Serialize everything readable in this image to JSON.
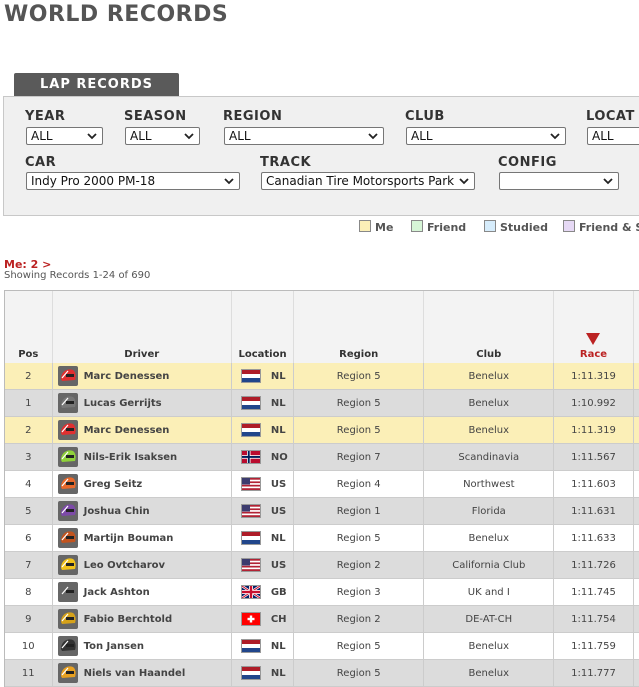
{
  "page": {
    "title": "WORLD RECORDS"
  },
  "tab": {
    "label": "LAP RECORDS"
  },
  "filters": {
    "year": {
      "label": "YEAR",
      "value": "ALL"
    },
    "season": {
      "label": "SEASON",
      "value": "ALL"
    },
    "region": {
      "label": "REGION",
      "value": "ALL"
    },
    "club": {
      "label": "CLUB",
      "value": "ALL"
    },
    "location": {
      "label": "LOCAT",
      "value": "ALL"
    },
    "car": {
      "label": "CAR",
      "value": "Indy Pro 2000 PM-18"
    },
    "track": {
      "label": "TRACK",
      "value": "Canadian Tire Motorsports Park"
    },
    "config": {
      "label": "CONFIG",
      "value": ""
    }
  },
  "legend": [
    {
      "label": "Me",
      "color": "#fbefb7"
    },
    {
      "label": "Friend",
      "color": "#d6f5d6"
    },
    {
      "label": "Studied",
      "color": "#d6ecfb"
    },
    {
      "label": "Friend & St",
      "color": "#e6d9f5"
    }
  ],
  "me_link": "Me: 2 >",
  "showing": "Showing Records 1-24 of 690",
  "columns": {
    "pos": "Pos",
    "driver": "Driver",
    "location": "Location",
    "region": "Region",
    "club": "Club",
    "race": "Race"
  },
  "rows": [
    {
      "pos": "2",
      "driver": "Marc Denessen",
      "country": "NL",
      "region": "Region 5",
      "club": "Benelux",
      "time": "1:11.319",
      "style": "me",
      "helmet": "#e03030",
      "flag": "nl"
    },
    {
      "pos": "1",
      "driver": "Lucas Gerrijts",
      "country": "NL",
      "region": "Region 5",
      "club": "Benelux",
      "time": "1:10.992",
      "style": "even",
      "helmet": "#777777",
      "flag": "nl"
    },
    {
      "pos": "2",
      "driver": "Marc Denessen",
      "country": "NL",
      "region": "Region 5",
      "club": "Benelux",
      "time": "1:11.319",
      "style": "me",
      "helmet": "#e03030",
      "flag": "nl"
    },
    {
      "pos": "3",
      "driver": "Nils-Erik Isaksen",
      "country": "NO",
      "region": "Region 7",
      "club": "Scandinavia",
      "time": "1:11.567",
      "style": "even",
      "helmet": "#8fd23a",
      "flag": "no"
    },
    {
      "pos": "4",
      "driver": "Greg Seitz",
      "country": "US",
      "region": "Region 4",
      "club": "Northwest",
      "time": "1:11.603",
      "style": "odd",
      "helmet": "#e8682a",
      "flag": "us"
    },
    {
      "pos": "5",
      "driver": "Joshua Chin",
      "country": "US",
      "region": "Region 1",
      "club": "Florida",
      "time": "1:11.631",
      "style": "even",
      "helmet": "#7d4aa8",
      "flag": "us"
    },
    {
      "pos": "6",
      "driver": "Martijn Bouman",
      "country": "NL",
      "region": "Region 5",
      "club": "Benelux",
      "time": "1:11.633",
      "style": "odd",
      "helmet": "#c2541f",
      "flag": "nl"
    },
    {
      "pos": "7",
      "driver": "Leo Ovtcharov",
      "country": "US",
      "region": "Region 2",
      "club": "California Club",
      "time": "1:11.726",
      "style": "even",
      "helmet": "#f2c21a",
      "flag": "us"
    },
    {
      "pos": "8",
      "driver": "Jack Ashton",
      "country": "GB",
      "region": "Region 3",
      "club": "UK and I",
      "time": "1:11.745",
      "style": "odd",
      "helmet": "#666666",
      "flag": "gb"
    },
    {
      "pos": "9",
      "driver": "Fabio Berchtold",
      "country": "CH",
      "region": "Region 2",
      "club": "DE-AT-CH",
      "time": "1:11.754",
      "style": "even",
      "helmet": "#d6a21a",
      "flag": "ch"
    },
    {
      "pos": "10",
      "driver": "Ton Jansen",
      "country": "NL",
      "region": "Region 5",
      "club": "Benelux",
      "time": "1:11.759",
      "style": "odd",
      "helmet": "#333333",
      "flag": "nl"
    },
    {
      "pos": "11",
      "driver": "Niels van Haandel",
      "country": "NL",
      "region": "Region 5",
      "club": "Benelux",
      "time": "1:11.777",
      "style": "even",
      "helmet": "#e8a020",
      "flag": "nl"
    }
  ]
}
